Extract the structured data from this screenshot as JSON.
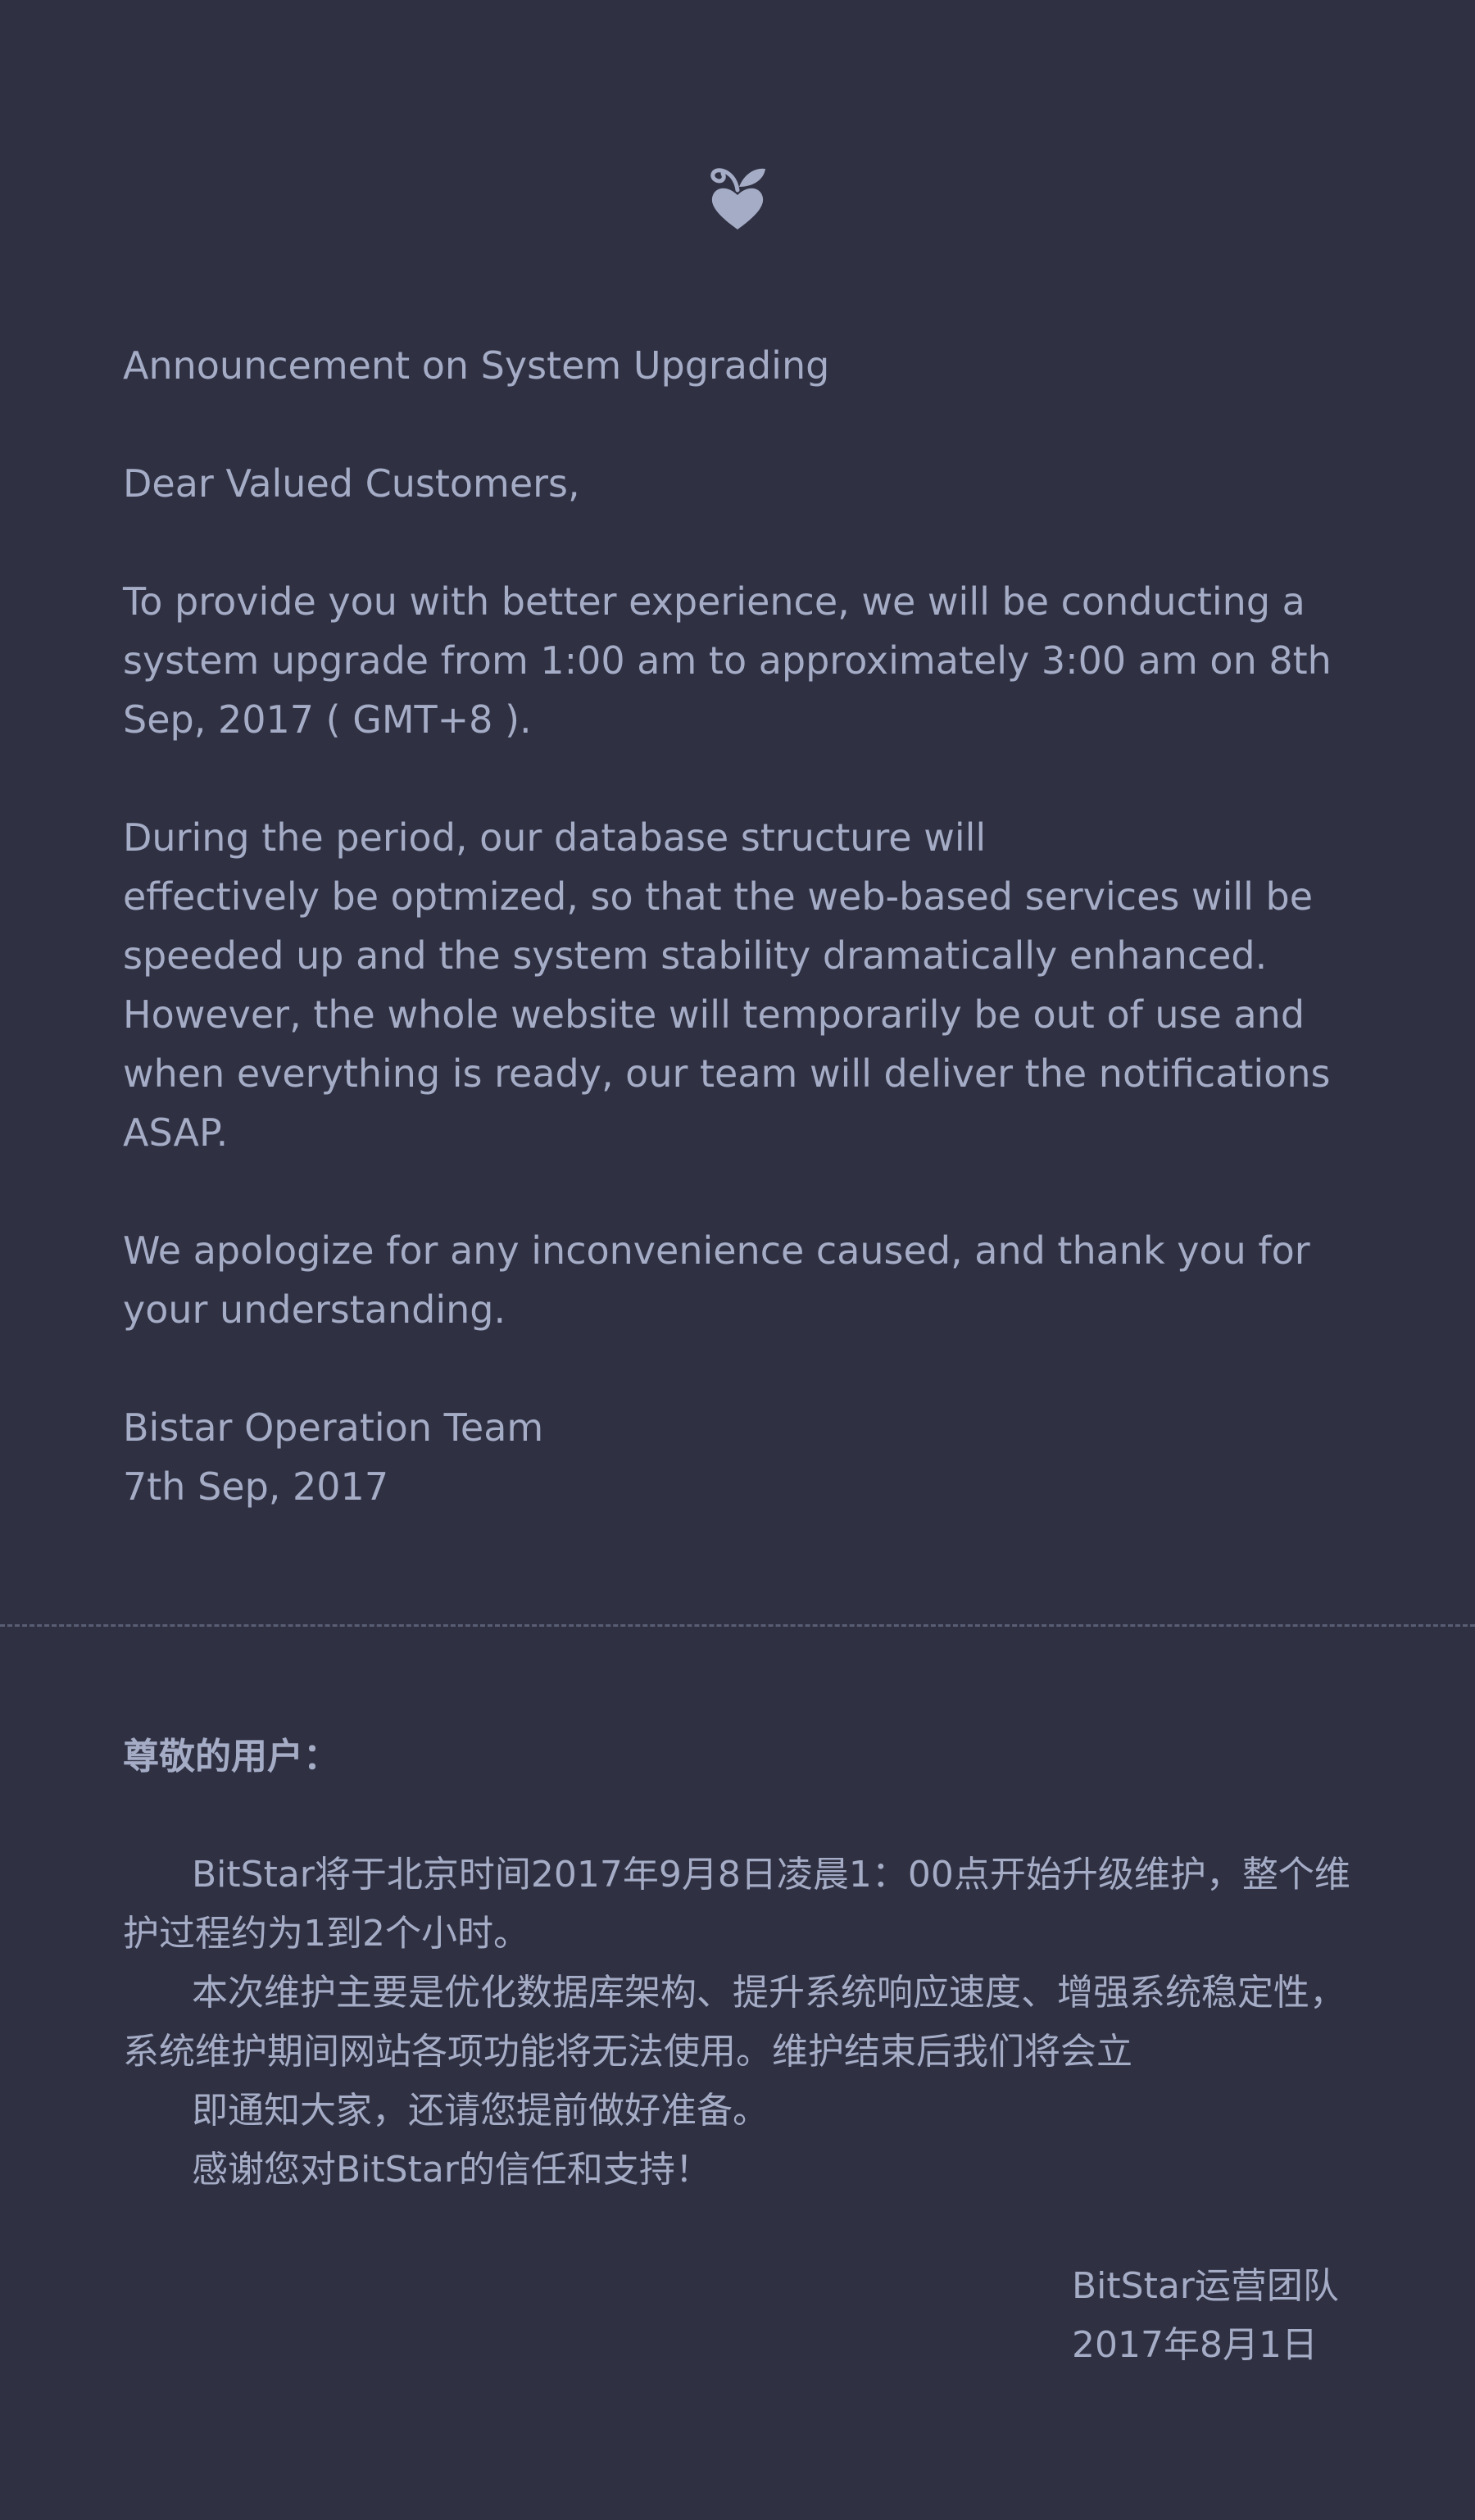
{
  "brand": {
    "logo_icon": "heart-sprout-logo-icon",
    "color": "#a5acc6"
  },
  "english": {
    "title": "Announcement on System Upgrading",
    "salutation": "Dear Valued Customers,",
    "para1": "To provide you with better experience, we will be conducting a system upgrade from 1:00 am to approximately 3:00 am on 8th Sep, 2017 ( GMT+8 ).",
    "para2_line1": "During the period, our database structure will",
    "para2_rest": "effectively be optmized, so that the web-based services will be speeded up and the system stability dramatically enhanced. However, the whole website will temporarily be out of use and when everything is ready, our team will deliver the notifications ASAP.",
    "para3": "We apologize for any inconvenience caused, and thank you for your understanding.",
    "team": "Bistar Operation Team",
    "date": "7th Sep, 2017"
  },
  "chinese": {
    "salutation": "尊敬的用户：",
    "para1": "BitStar将于北京时间2017年9月8日凌晨1：00点开始升级维护，整个维护过程约为1到2个小时。",
    "para2_a": "本次维护主要是优化数据库架构、提升系统响应速度、增强系统稳定性，系统维护期间网站各项功能将无法使用。维护结束后我们将会立",
    "para2_b": "即通知大家，还请您提前做好准备。",
    "para3": "感谢您对BitStar的信任和支持！",
    "team": "BitStar运营团队",
    "date": "2017年8月1日"
  }
}
